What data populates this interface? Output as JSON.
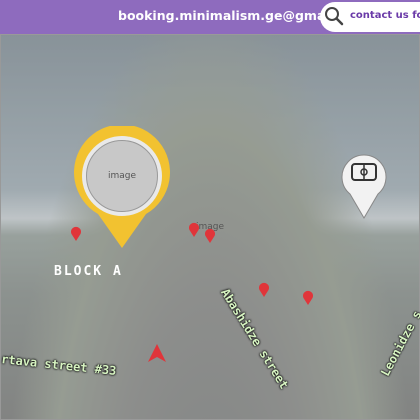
{
  "header": {
    "email": "booking.minimalism.ge@gmail.com",
    "contact_label": "contact us for D"
  },
  "markers": {
    "building_label": "BLOCK A"
  },
  "streets": {
    "street_1": "Abashidze street",
    "street_2": "rtava street #33",
    "street_3": "Leonidze s"
  },
  "icons": {
    "search": "search-icon",
    "pin": "map-pin-icon",
    "stadium": "stadium-icon",
    "arrow": "navigation-arrow-icon"
  },
  "colors": {
    "topbar": "#8e6bbe",
    "contact_text": "#6a3aa8",
    "pin_yellow": "#f2c230",
    "pin_red": "#e0353a",
    "street_label": "#d7f4c2"
  }
}
